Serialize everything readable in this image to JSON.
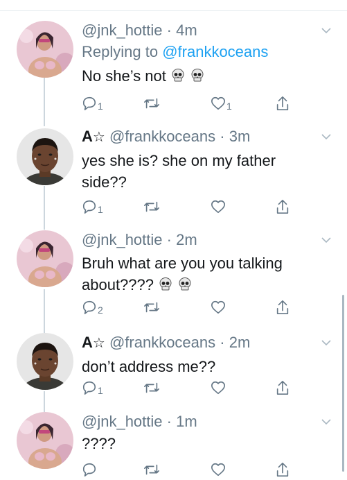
{
  "tweets": [
    {
      "display_name": "",
      "handle": "@jnk_hottie",
      "time": "4m",
      "replying_prefix": "Replying to",
      "replying_to": "@frankkoceans",
      "text": "No she’s not",
      "emoji": [
        "skull",
        "skull"
      ],
      "reply_count": "1",
      "retweet_count": "",
      "like_count": "1"
    },
    {
      "display_name": "A",
      "display_name_symbol": "☆",
      "handle": "@frankkoceans",
      "time": "3m",
      "text": "yes she is? she on my father side??",
      "emoji": [],
      "reply_count": "1",
      "retweet_count": "",
      "like_count": ""
    },
    {
      "display_name": "",
      "handle": "@jnk_hottie",
      "time": "2m",
      "text": "Bruh what are you you talking about????",
      "emoji": [
        "skull",
        "skull"
      ],
      "reply_count": "2",
      "retweet_count": "",
      "like_count": ""
    },
    {
      "display_name": "A",
      "display_name_symbol": "☆",
      "handle": "@frankkoceans",
      "time": "2m",
      "text": "don’t address me??",
      "emoji": [],
      "reply_count": "1",
      "retweet_count": "",
      "like_count": ""
    },
    {
      "display_name": "",
      "handle": "@jnk_hottie",
      "time": "1m",
      "text": "????",
      "emoji": [],
      "reply_count": "",
      "retweet_count": "",
      "like_count": ""
    }
  ],
  "separator": " · ",
  "colors": {
    "link": "#1da1f2",
    "secondary_text": "#657786",
    "thread_line": "#ccd6dd",
    "icon": "#657786"
  }
}
